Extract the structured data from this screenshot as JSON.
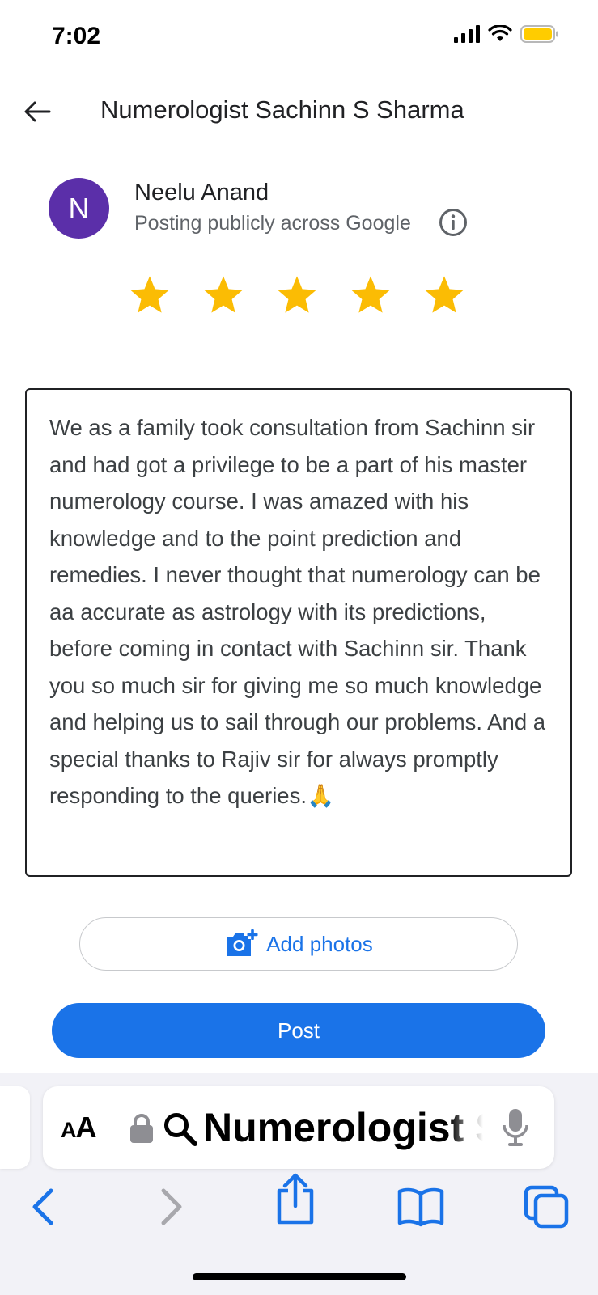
{
  "status_bar": {
    "time": "7:02"
  },
  "header": {
    "title": "Numerologist Sachinn S Sharma"
  },
  "user": {
    "initial": "N",
    "name": "Neelu Anand",
    "posting_note": "Posting publicly across Google",
    "avatar_color": "#5b2fa9"
  },
  "rating": {
    "selected": 5,
    "max": 5,
    "star_color": "#fbbc04"
  },
  "review": {
    "text": "We as a family took consultation from Sachinn sir and had got a  privilege to be a part of his master numerology course. I was amazed with his knowledge and to the point prediction and remedies. I never thought that numerology can be aa accurate as astrology with its predictions, before coming in contact with Sachinn sir. Thank you so much sir for giving me so much knowledge and helping us to sail through our problems. And a special thanks to Rajiv sir for always promptly responding to the queries.🙏"
  },
  "actions": {
    "add_photos_label": "Add photos",
    "post_label": "Post",
    "accent_color": "#1a73e8"
  },
  "browser": {
    "text_size_label_large": "A",
    "text_size_label_small": "A",
    "address_text": "Numerologist Sachinn S Sharma"
  },
  "icons": [
    "back-arrow-icon",
    "info-icon",
    "star-icon",
    "add-photo-icon",
    "lock-icon",
    "search-icon",
    "microphone-icon",
    "back-icon",
    "forward-icon",
    "share-icon",
    "bookmarks-icon",
    "tabs-icon"
  ]
}
